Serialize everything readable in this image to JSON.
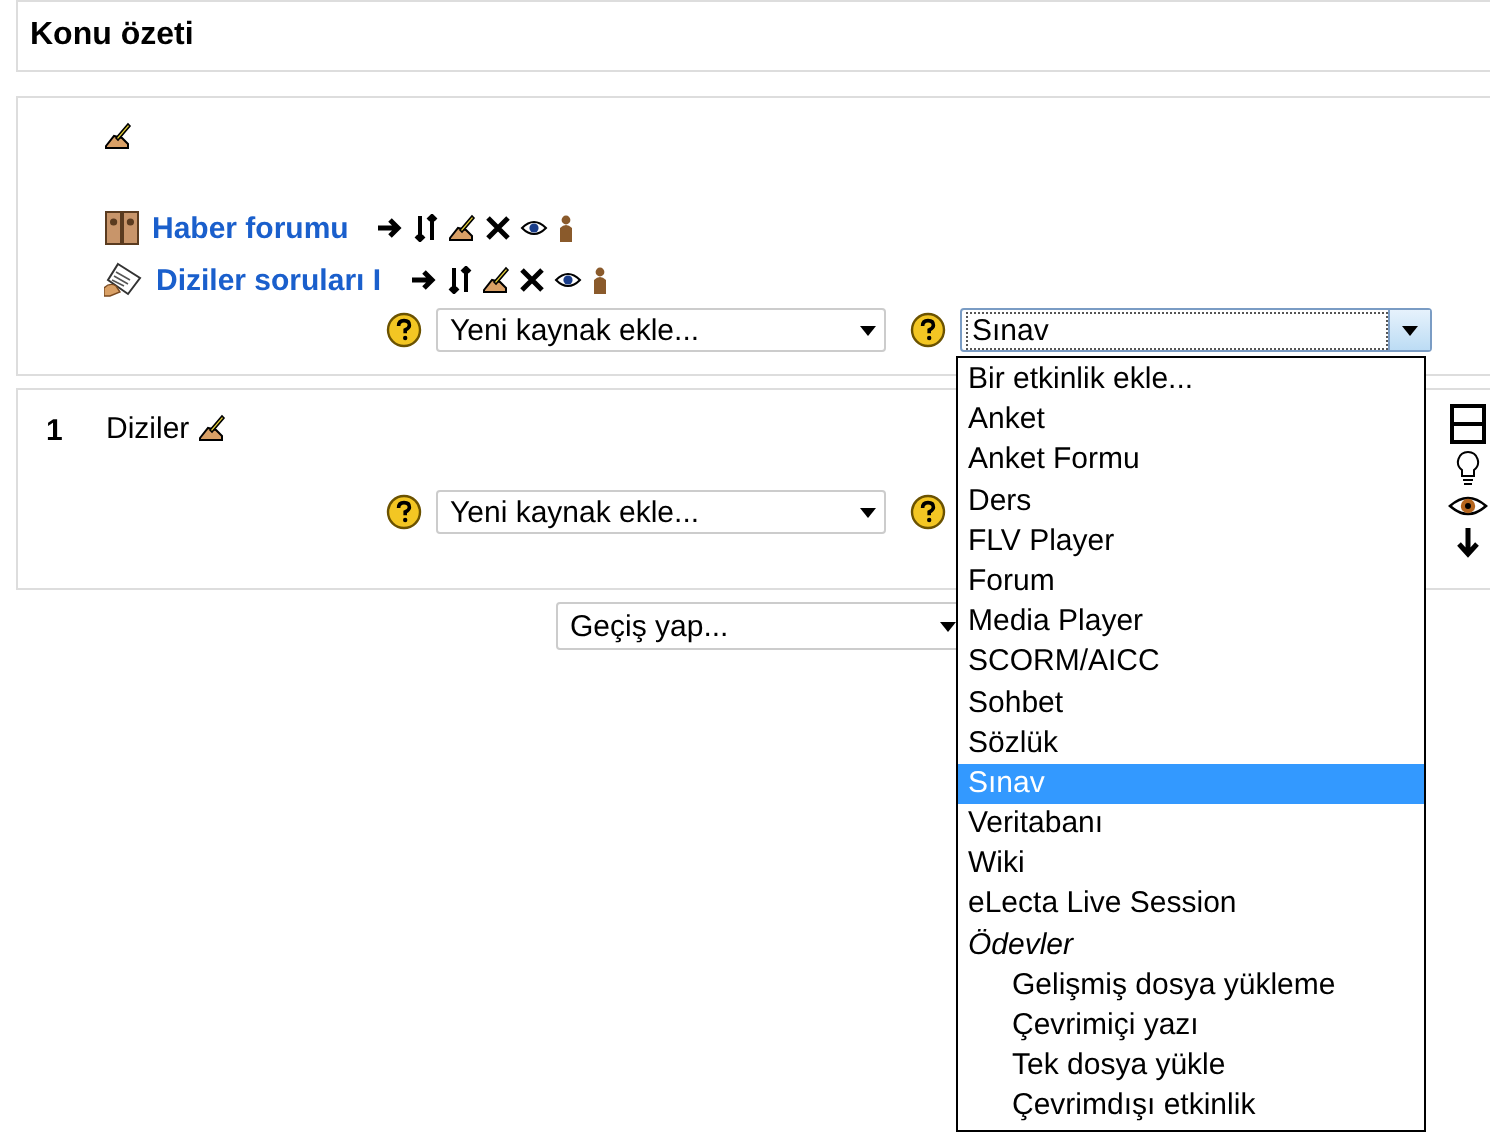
{
  "header": {
    "title": "Konu özeti"
  },
  "sections": [
    {
      "activities": [
        {
          "title": "Haber forumu",
          "kind": "forum"
        },
        {
          "title": "Diziler soruları I",
          "kind": "quiz"
        }
      ],
      "resource_select": {
        "value": "Yeni kaynak ekle..."
      },
      "activity_select": {
        "value": "Sınav",
        "expanded": true
      }
    },
    {
      "number": "1",
      "title": "Diziler",
      "resource_select": {
        "value": "Yeni kaynak ekle..."
      }
    }
  ],
  "jump_select": {
    "value": "Geçiş yap..."
  },
  "dropdown": {
    "options": [
      {
        "label": "Bir etkinlik ekle...",
        "kind": "option",
        "selected": false
      },
      {
        "label": "Anket",
        "kind": "option",
        "selected": false
      },
      {
        "label": "Anket Formu",
        "kind": "option",
        "selected": false
      },
      {
        "label": "Ders",
        "kind": "option",
        "selected": false
      },
      {
        "label": "FLV Player",
        "kind": "option",
        "selected": false
      },
      {
        "label": "Forum",
        "kind": "option",
        "selected": false
      },
      {
        "label": "Media Player",
        "kind": "option",
        "selected": false
      },
      {
        "label": "SCORM/AICC",
        "kind": "option",
        "selected": false
      },
      {
        "label": "Sohbet",
        "kind": "option",
        "selected": false
      },
      {
        "label": "Sözlük",
        "kind": "option",
        "selected": false
      },
      {
        "label": "Sınav",
        "kind": "option",
        "selected": true
      },
      {
        "label": "Veritabanı",
        "kind": "option",
        "selected": false
      },
      {
        "label": "Wiki",
        "kind": "option",
        "selected": false
      },
      {
        "label": "eLecta Live Session",
        "kind": "option",
        "selected": false
      },
      {
        "label": "Ödevler",
        "kind": "group",
        "children": [
          {
            "label": "Gelişmiş dosya yükleme",
            "kind": "option",
            "selected": false
          },
          {
            "label": "Çevrimiçi yazı",
            "kind": "option",
            "selected": false
          },
          {
            "label": "Tek dosya yükle",
            "kind": "option",
            "selected": false
          },
          {
            "label": "Çevrimdışı etkinlik",
            "kind": "option",
            "selected": false
          }
        ]
      }
    ]
  }
}
